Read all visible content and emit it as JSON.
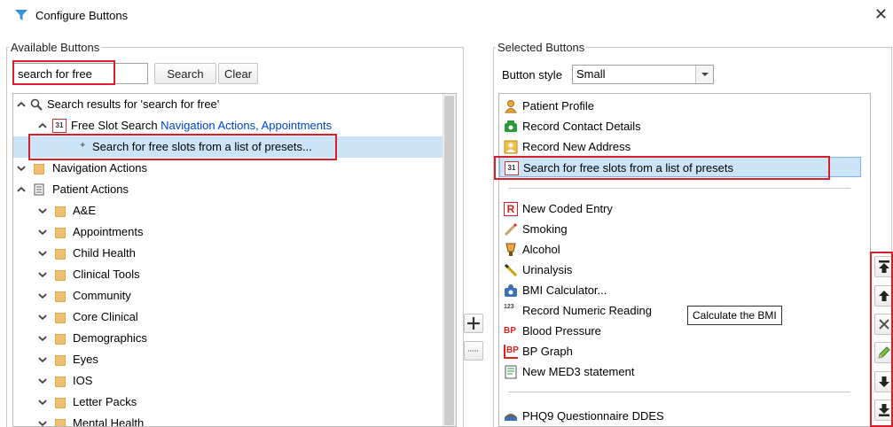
{
  "window": {
    "title": "Configure Buttons",
    "close_glyph": "✕"
  },
  "available": {
    "legend": "Available Buttons",
    "search_value": "search for free",
    "search_button": "Search",
    "clear_button": "Clear",
    "tree": [
      {
        "label": "Search results for 'search for free'"
      },
      {
        "label": "Free Slot Search",
        "nav": "Navigation Actions, Appointments"
      },
      {
        "label": "Search for free slots from a list of presets..."
      },
      {
        "label": "Navigation Actions"
      },
      {
        "label": "Patient Actions"
      },
      {
        "label": "A&E"
      },
      {
        "label": "Appointments"
      },
      {
        "label": "Child Health"
      },
      {
        "label": "Clinical Tools"
      },
      {
        "label": "Community"
      },
      {
        "label": "Core Clinical"
      },
      {
        "label": "Demographics"
      },
      {
        "label": "Eyes"
      },
      {
        "label": "IOS"
      },
      {
        "label": "Letter Packs"
      },
      {
        "label": "Mental Health"
      }
    ]
  },
  "selected": {
    "legend": "Selected Buttons",
    "style_label": "Button style",
    "style_value": "Small",
    "items": [
      {
        "label": "Patient Profile",
        "icon": "patient-profile-icon"
      },
      {
        "label": "Record Contact Details",
        "icon": "phone-icon"
      },
      {
        "label": "Record New Address",
        "icon": "address-icon"
      },
      {
        "label": "Search for free slots from a list of presets",
        "icon": "calendar-icon"
      },
      {
        "label": "New Coded Entry",
        "icon": "coded-entry-icon"
      },
      {
        "label": "Smoking",
        "icon": "smoking-icon"
      },
      {
        "label": "Alcohol",
        "icon": "alcohol-icon"
      },
      {
        "label": "Urinalysis",
        "icon": "urinalysis-icon"
      },
      {
        "label": "BMI Calculator...",
        "icon": "bmi-icon"
      },
      {
        "label": "Record Numeric Reading",
        "icon": "numeric-icon"
      },
      {
        "label": "Blood Pressure",
        "icon": "bp-icon"
      },
      {
        "label": "BP Graph",
        "icon": "bp-graph-icon"
      },
      {
        "label": "New MED3 statement",
        "icon": "med3-icon"
      },
      {
        "label": "PHQ9 Questionnaire DDES",
        "icon": "phq9-icon"
      }
    ],
    "tooltip": "Calculate the BMI"
  },
  "icon_text": {
    "calendar": "31",
    "bp": "BP",
    "coded": "R",
    "numeric": "123"
  },
  "colors": {
    "selection": "#cce4f7",
    "highlight": "#d81e2b",
    "link": "#0044cc"
  }
}
